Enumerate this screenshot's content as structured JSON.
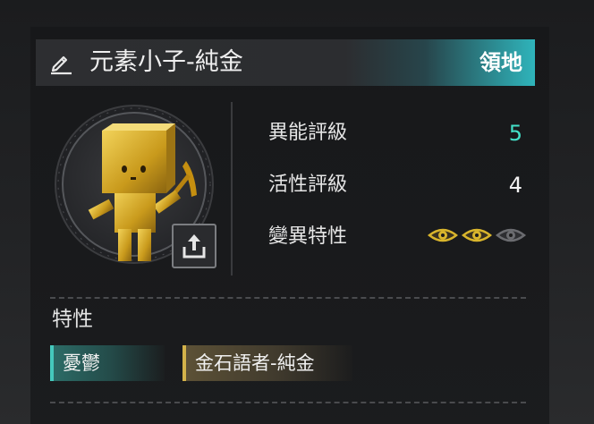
{
  "header": {
    "name": "元素小子-純金",
    "territory_label": "領地"
  },
  "stats": [
    {
      "label": "異能評級",
      "value": "5",
      "color": "#43e0c8"
    },
    {
      "label": "活性評級",
      "value": "4",
      "color": "#f2f2f2"
    },
    {
      "label": "變異特性",
      "eyes_lit": 2,
      "eyes_total": 3
    }
  ],
  "traits": {
    "title": "特性",
    "tags": [
      {
        "label": "憂鬱",
        "accent": "#45c9bd"
      },
      {
        "label": "金石語者-純金",
        "accent": "#d3b24a"
      }
    ]
  },
  "colors": {
    "header_accent": "#2fb4bb",
    "gold": "#d9b52c"
  },
  "icons": [
    "edit-icon",
    "share-upload-icon",
    "eye-icon"
  ]
}
